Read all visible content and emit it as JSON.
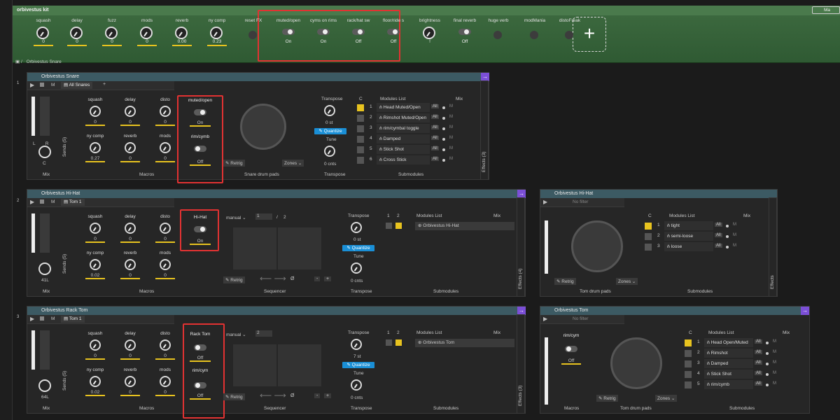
{
  "kit": {
    "title": "orbivestus kit",
    "menu_label": "Ma",
    "macros": [
      {
        "label": "squash",
        "value": "0"
      },
      {
        "label": "delay",
        "value": "0"
      },
      {
        "label": "fuzz",
        "value": "0"
      },
      {
        "label": "mods",
        "value": "0"
      },
      {
        "label": "reverb",
        "value": "0.00"
      },
      {
        "label": "ny comp",
        "value": "0.23"
      },
      {
        "label": "reset FX",
        "value": ""
      },
      {
        "label": "muted/open",
        "value": "On"
      },
      {
        "label": "cyms on rims",
        "value": "On"
      },
      {
        "label": "rack/hat sw",
        "value": "Off"
      },
      {
        "label": "floor/ride s",
        "value": "Off"
      },
      {
        "label": "brightness",
        "value": "!"
      },
      {
        "label": "final reverb",
        "value": "Off"
      },
      {
        "label": "huge verb",
        "value": ""
      },
      {
        "label": "modMania",
        "value": ""
      },
      {
        "label": "distoFreak",
        "value": ""
      }
    ]
  },
  "breadcrumb": "Orbivestus Snare",
  "tracks": [
    {
      "index": "1",
      "title": "Orbivestus Snare",
      "preset": "All Snares",
      "mix_value": "C",
      "mix_label": "Mix",
      "sends_label": "Sends (5)",
      "macros_label": "Macros",
      "knobs": [
        {
          "label": "squash",
          "value": "0"
        },
        {
          "label": "delay",
          "value": "0"
        },
        {
          "label": "disto",
          "value": "0"
        },
        {
          "label": "ny comp",
          "value": "0.27"
        },
        {
          "label": "reverb",
          "value": "0"
        },
        {
          "label": "mods",
          "value": "0"
        }
      ],
      "toggles": [
        {
          "label": "muted/open",
          "value": "On"
        },
        {
          "label": "rim/cymb",
          "value": "Off"
        }
      ],
      "pads_label": "Snare drum pads",
      "retrig": "Retrig",
      "zones": "Zones",
      "transpose_title": "Transpose",
      "transpose_value": "0 st",
      "quantize": "Quantize",
      "tune_title": "Tune",
      "tune_value": "0 cnts",
      "transpose_footer": "Transpose",
      "modules_header": "Modules List",
      "col_c": "C",
      "mix_col": "Mix",
      "modules": [
        "Head Muted/Open",
        "Rimshot Muted/Open",
        "rim/cymbal toggle",
        "Damped",
        "Stick Shot",
        "Cross Stick"
      ],
      "submodules_label": "Submodules",
      "effects_label": "Effects (3)"
    }
  ],
  "hihat": {
    "index": "2",
    "title": "Orbivestus Hi-Hat",
    "preset": "Tom 1",
    "mix_value": "41L",
    "knobs": [
      {
        "label": "squash",
        "value": "0"
      },
      {
        "label": "delay",
        "value": "0"
      },
      {
        "label": "disto",
        "value": "0"
      },
      {
        "label": "ny comp",
        "value": "0.02"
      },
      {
        "label": "reverb",
        "value": "0"
      },
      {
        "label": "mods",
        "value": "0"
      }
    ],
    "toggle": {
      "label": "Hi-Hat",
      "value": "On"
    },
    "seq_mode": "manual",
    "seq_page": "1",
    "seq_total": "2",
    "seq_label": "Sequencer",
    "transpose_value": "0 st",
    "tune_value": "0 cnts",
    "module": "Orbivestus Hi-Hat",
    "effects_label": "Effects (4)",
    "right_title": "Orbivestus Hi-Hat",
    "right_filter": "No filter",
    "right_modules": [
      "tight",
      "semi-loose",
      "loose"
    ],
    "right_pads": "Tom drum pads"
  },
  "racktom": {
    "index": "3",
    "title": "Orbivestus Rack Tom",
    "preset": "Tom 1",
    "mix_value": "64L",
    "knobs": [
      {
        "label": "squash",
        "value": "0"
      },
      {
        "label": "delay",
        "value": "0"
      },
      {
        "label": "disto",
        "value": "0"
      },
      {
        "label": "ny comp",
        "value": "0.02"
      },
      {
        "label": "reverb",
        "value": "0"
      },
      {
        "label": "mods",
        "value": "0"
      }
    ],
    "toggles": [
      {
        "label": "Rack Tom",
        "value": "Off"
      },
      {
        "label": "rim/cym",
        "value": "Off"
      }
    ],
    "seq_page": "2",
    "transpose_value": "7 st",
    "tune_value": "0 cnts",
    "module": "Orbivestus Tom",
    "effects_label": "Effects (3)",
    "right_title": "Orbivestus Tom",
    "right_toggle_label": "rim/cym",
    "right_toggle_value": "Off",
    "right_modules": [
      "Head Open/Muted",
      "Rimshot Open/Muted",
      "Damped",
      "Stick Shot",
      "rim/cymb"
    ],
    "right_pads": "Tom drum pads",
    "right_macros": "Macros"
  },
  "common": {
    "all": "All",
    "m": "M",
    "plus": "+",
    "minus": "-",
    "slash": "/",
    "null_sym": "Ø",
    "c_col": "C",
    "one": "1",
    "two": "2"
  }
}
